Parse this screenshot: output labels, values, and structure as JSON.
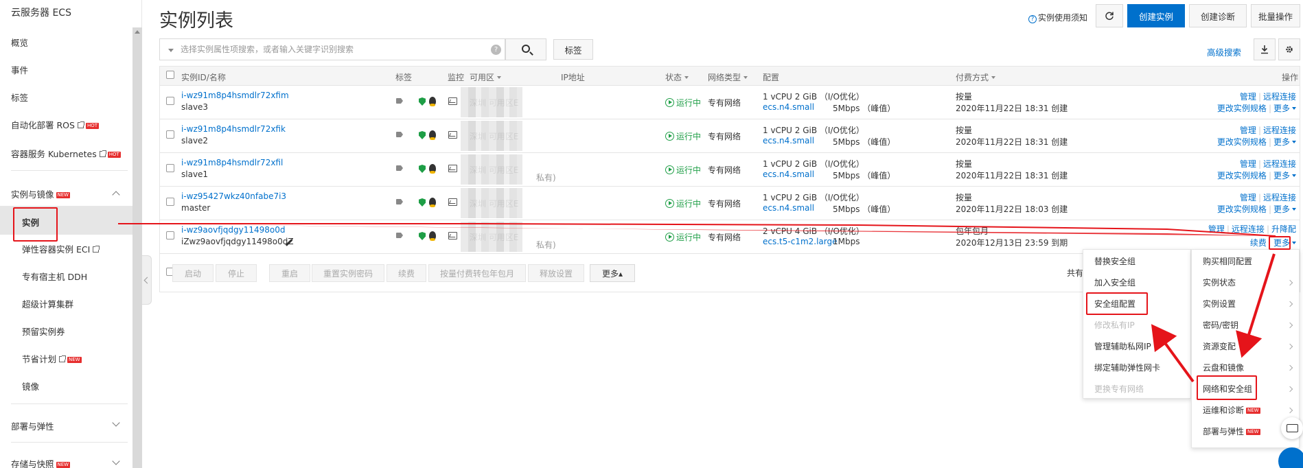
{
  "sidebar": {
    "title": "云服务器 ECS",
    "items": [
      {
        "label": "概览"
      },
      {
        "label": "事件"
      },
      {
        "label": "标签"
      },
      {
        "label": "自动化部署 ROS",
        "badge": "HOT"
      },
      {
        "label": "容器服务 Kubernetes",
        "badge": "HOT"
      }
    ],
    "group_instances": {
      "label": "实例与镜像",
      "badge": "NEW"
    },
    "sub_items": [
      {
        "label": "实例"
      },
      {
        "label": "弹性容器实例 ECI"
      },
      {
        "label": "专有宿主机 DDH"
      },
      {
        "label": "超级计算集群"
      },
      {
        "label": "预留实例券"
      },
      {
        "label": "节省计划",
        "badge": "NEW"
      },
      {
        "label": "镜像"
      }
    ],
    "group_deploy": {
      "label": "部署与弹性"
    },
    "group_storage": {
      "label": "存储与快照",
      "badge": "NEW"
    }
  },
  "header": {
    "title": "实例列表",
    "help": "实例使用须知",
    "buttons": {
      "create": "创建实例",
      "diagnose": "创建诊断",
      "batch": "批量操作"
    }
  },
  "search": {
    "placeholder": "选择实例属性项搜索，或者输入关键字识别搜索",
    "tag_button": "标签",
    "advanced": "高级搜索"
  },
  "table": {
    "headers": {
      "id": "实例ID/名称",
      "tag": "标签",
      "monitor": "监控",
      "zone": "可用区",
      "ip": "IP地址",
      "status": "状态",
      "network": "网络类型",
      "config": "配置",
      "billing": "付费方式",
      "ops": "操作"
    },
    "rows": [
      {
        "id": "i-wz91m8p4hsmdlr72xfim",
        "name": "slave3",
        "zone": "深圳 可用区E",
        "status": "运行中",
        "network": "专有网络",
        "cpu": "1 vCPU 2 GiB （I/O优化）",
        "type": "ecs.n4.small",
        "bw": "5Mbps （峰值）",
        "billing": "按量",
        "created": "2020年11月22日 18:31 创建",
        "op1": "管理",
        "op2": "远程连接",
        "op3": "更改实例规格",
        "op4": "更多"
      },
      {
        "id": "i-wz91m8p4hsmdlr72xfik",
        "name": "slave2",
        "zone": "深圳 可用区E",
        "status": "运行中",
        "network": "专有网络",
        "cpu": "1 vCPU 2 GiB （I/O优化）",
        "type": "ecs.n4.small",
        "bw": "5Mbps （峰值）",
        "billing": "按量",
        "created": "2020年11月22日 18:31 创建",
        "op1": "管理",
        "op2": "远程连接",
        "op3": "更改实例规格",
        "op4": "更多"
      },
      {
        "id": "i-wz91m8p4hsmdlr72xfil",
        "name": "slave1",
        "zone": "深圳 可用区E",
        "status": "运行中",
        "network": "专有网络",
        "cpu": "1 vCPU 2 GiB （I/O优化）",
        "type": "ecs.n4.small",
        "bw": "5Mbps （峰值）",
        "billing": "按量",
        "created": "2020年11月22日 18:31 创建",
        "ip_suffix": "私有)",
        "op1": "管理",
        "op2": "远程连接",
        "op3": "更改实例规格",
        "op4": "更多"
      },
      {
        "id": "i-wz95427wkz40nfabe7i3",
        "name": "master",
        "zone": "深圳 可用区E",
        "status": "运行中",
        "network": "专有网络",
        "cpu": "1 vCPU 2 GiB （I/O优化）",
        "type": "ecs.n4.small",
        "bw": "5Mbps （峰值）",
        "billing": "按量",
        "created": "2020年11月22日 18:03 创建",
        "op1": "管理",
        "op2": "远程连接",
        "op3": "更改实例规格",
        "op4": "更多"
      },
      {
        "id": "i-wz9aovfjqdgy11498o0d",
        "name": "iZwz9aovfjqdgy11498o0dZ",
        "zone": "深圳 可用区E",
        "status": "运行中",
        "network": "专有网络",
        "cpu": "2 vCPU 4 GiB （I/O优化）",
        "type": "ecs.t5-c1m2.large",
        "bw": "1Mbps",
        "billing": "包年包月",
        "created": "2020年12月13日 23:59 到期",
        "ip_suffix": "私有)",
        "op1": "管理",
        "op2": "远程连接",
        "op2b": "升降配",
        "op3": "续费",
        "op4": "更多"
      }
    ],
    "footer_buttons": [
      "启动",
      "停止",
      "重启",
      "重置实例密码",
      "续费",
      "按量付费转包年包月",
      "释放设置",
      "更多▴"
    ],
    "footer_right": "共有"
  },
  "menu_main": [
    {
      "label": "购买相同配置",
      "sub": false
    },
    {
      "label": "实例状态",
      "sub": true
    },
    {
      "label": "实例设置",
      "sub": true
    },
    {
      "label": "密码/密钥",
      "sub": true
    },
    {
      "label": "资源变配",
      "sub": true
    },
    {
      "label": "云盘和镜像",
      "sub": true
    },
    {
      "label": "网络和安全组",
      "sub": true
    },
    {
      "label": "运维和诊断",
      "sub": true,
      "badge": "NEW"
    },
    {
      "label": "部署与弹性",
      "sub": true,
      "badge": "NEW"
    }
  ],
  "menu_sub": [
    {
      "label": "替换安全组",
      "disabled": false
    },
    {
      "label": "加入安全组",
      "disabled": false
    },
    {
      "label": "安全组配置",
      "disabled": false
    },
    {
      "label": "修改私有IP",
      "disabled": true
    },
    {
      "label": "管理辅助私网IP",
      "disabled": false
    },
    {
      "label": "绑定辅助弹性网卡",
      "disabled": false
    },
    {
      "label": "更换专有网络",
      "disabled": true
    }
  ],
  "colors": {
    "accent": "#0070cc",
    "running": "#1e9e46",
    "annotation": "#e5141a"
  },
  "icons": [
    "refresh-icon",
    "search-icon",
    "download-icon",
    "gear-icon",
    "tag-icon",
    "shield-icon",
    "linux-icon",
    "monitor-icon",
    "run-status-icon",
    "edit-icon",
    "chat-icon"
  ]
}
